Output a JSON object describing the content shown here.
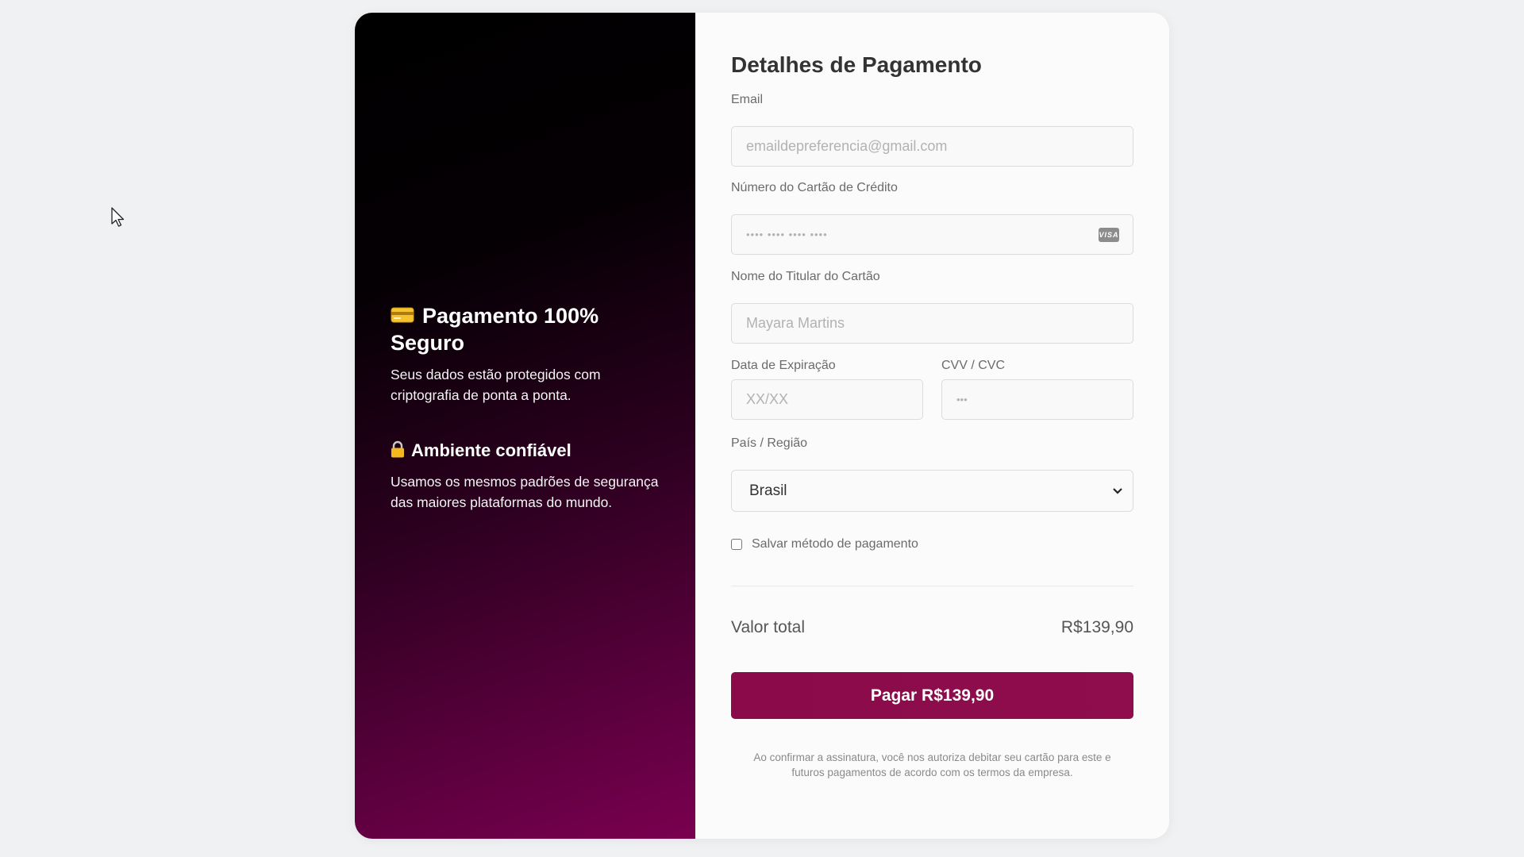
{
  "left_panel": {
    "feature1": {
      "icon": "credit-card-icon",
      "title": "Pagamento 100% Seguro",
      "text": "Seus dados estão protegidos com criptografia de ponta a ponta."
    },
    "feature2": {
      "icon": "lock-icon",
      "title": "Ambiente confiável",
      "text": "Usamos os mesmos padrões de segurança das maiores plataformas do mundo."
    }
  },
  "form": {
    "title": "Detalhes de Pagamento",
    "email": {
      "label": "Email",
      "placeholder": "emaildepreferencia@gmail.com"
    },
    "card_number": {
      "label": "Número do Cartão de Crédito",
      "placeholder": "•••• •••• •••• ••••",
      "brand": "VISA"
    },
    "holder_name": {
      "label": "Nome do Titular do Cartão",
      "placeholder": "Mayara Martins"
    },
    "expiry": {
      "label": "Data de Expiração",
      "placeholder": "XX/XX"
    },
    "cvv": {
      "label": "CVV / CVC",
      "placeholder": "•••"
    },
    "country": {
      "label": "País / Região",
      "selected": "Brasil"
    },
    "save_method": {
      "label": "Salvar método de pagamento",
      "checked": false
    },
    "total": {
      "label": "Valor total",
      "value": "R$139,90"
    },
    "pay_button": "Pagar R$139,90",
    "disclaimer_line1": "Ao confirmar a assinatura, você nos autoriza debitar seu cartão para este e",
    "disclaimer_line2": "futuros pagamentos de acordo com os termos da empresa."
  },
  "colors": {
    "accent": "#8a0a4a",
    "page_background": "#f0f1f3"
  }
}
